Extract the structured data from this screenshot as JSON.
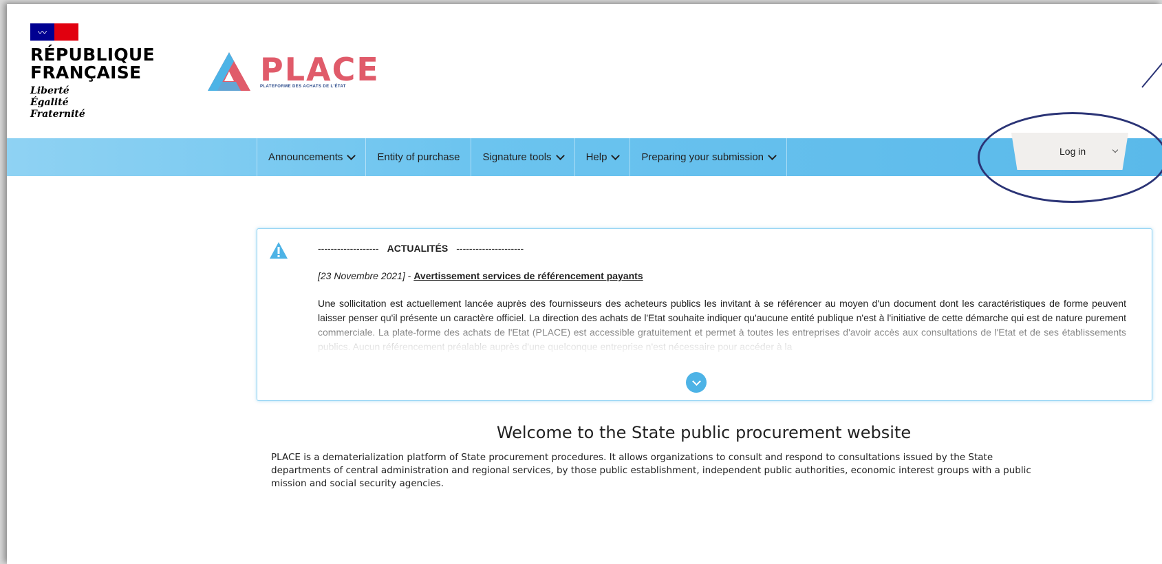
{
  "header": {
    "republique": [
      "RÉPUBLIQUE",
      "FRANÇAISE"
    ],
    "motto": [
      "Liberté",
      "Égalité",
      "Fraternité"
    ],
    "place_word": "PLACE",
    "place_sub": "PLATEFORME DES ACHATS DE L'ÉTAT"
  },
  "nav": {
    "items": [
      {
        "label": "Announcements",
        "has_dropdown": true
      },
      {
        "label": "Entity of purchase",
        "has_dropdown": false
      },
      {
        "label": "Signature tools",
        "has_dropdown": true
      },
      {
        "label": "Help",
        "has_dropdown": true
      },
      {
        "label": "Preparing your submission",
        "has_dropdown": true
      }
    ],
    "login_label": "Log in"
  },
  "news": {
    "dashes_left": "-------------------",
    "heading": "ACTUALITÉS",
    "dashes_right": "---------------------",
    "date": "[23 Novembre 2021]",
    "separator": " - ",
    "link": "Avertissement services de référencement payants",
    "body": "Une sollicitation est actuellement lancée auprès des fournisseurs des acheteurs publics les invitant à se référencer au moyen d'un document dont les caractéristiques de forme peuvent laisser penser qu'il présente un caractère officiel. La direction des achats de l'Etat souhaite indiquer qu'aucune entité publique n'est à l'initiative de cette démarche qui est de nature purement commerciale. La plate-forme des achats de l'Etat (PLACE) est accessible gratuitement et permet à toutes les entreprises d'avoir accès aux consultations de l'Etat et de ses établissements publics. Aucun référencement préalable auprès d'une quelconque entreprise n'est nécessaire pour accéder à la"
  },
  "main": {
    "welcome": "Welcome to the State public procurement website",
    "intro": "PLACE is a dematerialization platform of State procurement procedures. It allows organizations to consult and respond to consultations issued by the State departments of central administration and regional services, by those public establishment, independent public authorities, economic interest groups with a public mission and social security agencies."
  },
  "colors": {
    "navbar": "#5ab9ea",
    "place_red": "#e05b6a",
    "annotation": "#2b3476",
    "flag_blue": "#000091",
    "flag_red": "#e1000f"
  }
}
